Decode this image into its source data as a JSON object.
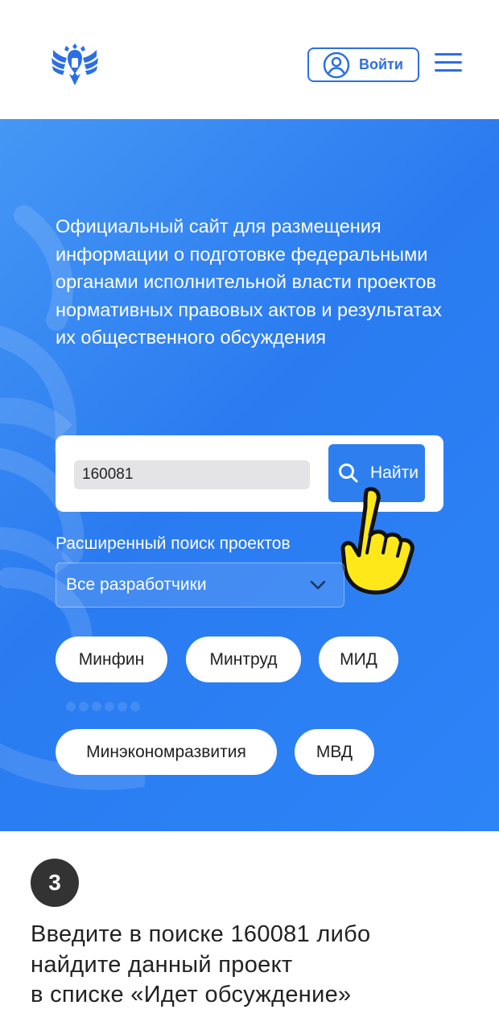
{
  "header": {
    "emblem_icon": "russian-coat-of-arms-icon",
    "login_label": "Войти",
    "user_icon": "user-circle-icon",
    "menu_icon": "hamburger-menu-icon",
    "accent_color": "#2d6fe2"
  },
  "hero": {
    "background_color": "#2c84f7",
    "description": "Официальный сайт для размещения информации о подготовке федеральными органами исполнительной власти проектов нормативных правовых актов и результатах их общественного обсуждения",
    "search": {
      "value": "160081",
      "button_label": "Найти",
      "button_icon": "search-icon"
    },
    "advanced_search_label": "Расширенный поиск проектов",
    "developer_select": {
      "selected": "Все разработчики",
      "icon": "chevron-down-icon"
    },
    "chips": [
      "Минфин",
      "Минтруд",
      "МИД",
      "Минэкономразвития",
      "МВД"
    ],
    "pointer_icon": "hand-pointer-icon"
  },
  "step": {
    "number": "3",
    "instruction": "Введите в поиске 160081 либо\nнайдите  данный проект\nв списке «Идет обсуждение»"
  }
}
